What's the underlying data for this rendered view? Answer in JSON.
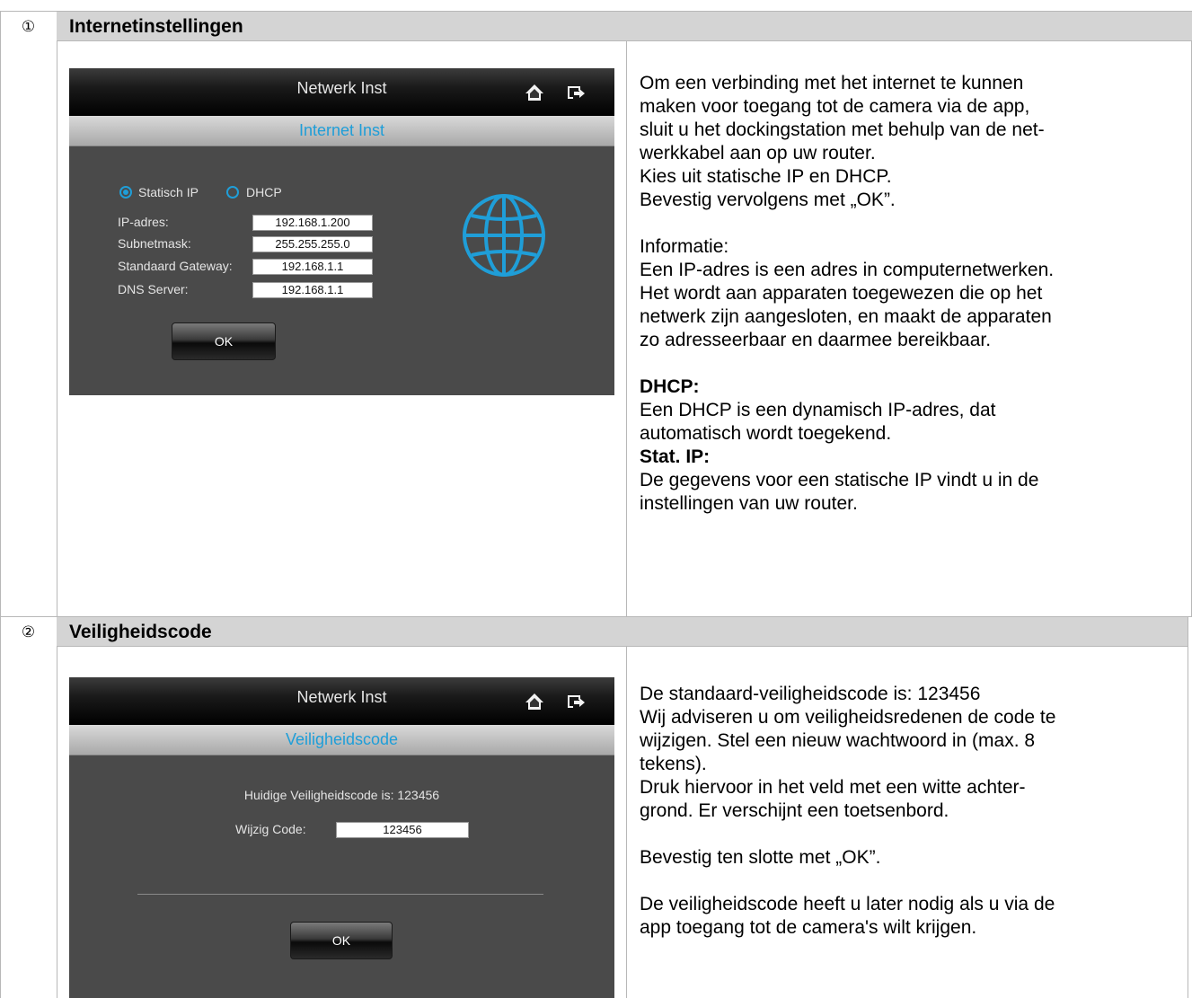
{
  "section1": {
    "number": "①",
    "heading": "Internetinstellingen",
    "screen": {
      "title": "Netwerk Inst",
      "subtitle": "Internet Inst",
      "home_icon": "home-icon",
      "exit_icon": "exit-icon",
      "radio_static_label": "Statisch IP",
      "radio_dhcp_label": "DHCP",
      "radio_selected": "static",
      "ip_label": "IP-adres:",
      "ip_value": "192.168.1.200",
      "subnet_label": "Subnetmask:",
      "subnet_value": "255.255.255.0",
      "gateway_label": "Standaard Gateway:",
      "gateway_value": "192.168.1.1",
      "dns_label": "DNS Server:",
      "dns_value": "192.168.1.1",
      "ok_label": "OK",
      "globe_icon": "globe-icon"
    },
    "text": {
      "intro": "Om een verbinding met het internet te kunnen\nmaken voor toegang tot de camera via de app,\nsluit u het dockingstation met behulp van de net-\nwerkkabel aan op uw router.\nKies uit statische IP en DHCP.\nBevestig vervolgens met „OK”.",
      "info_title": "Informatie:",
      "info_body": "Een IP-adres is een adres in computernetwerken.\nHet wordt aan apparaten toegewezen die op het\nnetwerk zijn aangesloten, en maakt de apparaten\nzo adresseerbaar en daarmee bereikbaar.",
      "dhcp_title": "DHCP:",
      "dhcp_body": "Een DHCP is een dynamisch IP-adres, dat\nautomatisch wordt toegekend.",
      "stat_title": "Stat. IP:",
      "stat_body": "De gegevens voor een statische IP vindt u in de\ninstellingen van uw router."
    }
  },
  "section2": {
    "number": "②",
    "heading": "Veiligheidscode",
    "screen": {
      "title": "Netwerk Inst",
      "subtitle": "Veiligheidscode",
      "home_icon": "home-icon",
      "exit_icon": "exit-icon",
      "current_code_text": "Huidige Veiligheidscode is: 123456",
      "change_label": "Wijzig Code:",
      "change_value": "123456",
      "ok_label": "OK"
    },
    "text": {
      "p1": "De standaard-veiligheidscode is: 123456\nWij adviseren u om veiligheidsredenen de code te\nwijzigen. Stel een nieuw wachtwoord in (max. 8\ntekens).\nDruk hiervoor in het veld met een witte achter-\ngrond. Er verschijnt een toetsenbord.",
      "p2": "Bevestig ten slotte met „OK”.",
      "p3": "De veiligheidscode heeft u later nodig als u via de\napp toegang tot de camera's wilt krijgen."
    }
  },
  "colors": {
    "accent": "#1f9ed8",
    "header_row": "#d4d4d4",
    "screen_bg": "#4a4a4a"
  }
}
